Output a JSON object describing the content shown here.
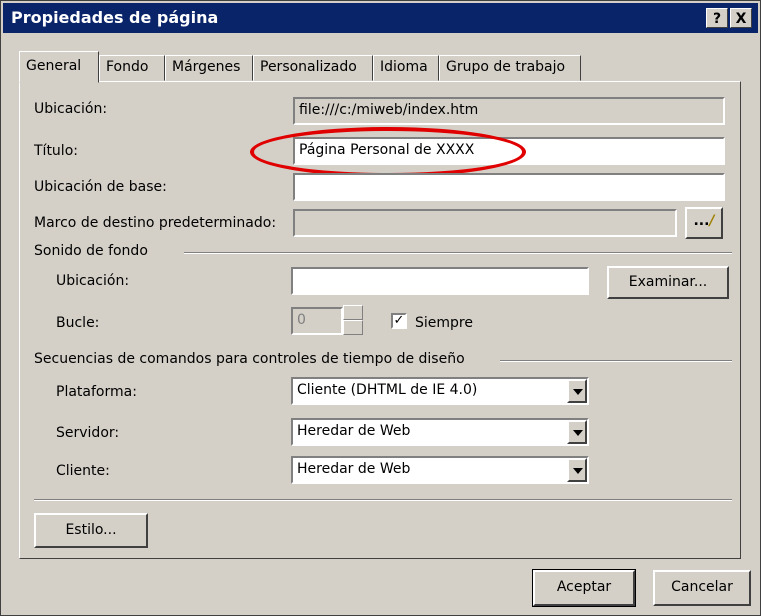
{
  "window": {
    "title": "Propiedades de página",
    "help_label": "?",
    "close_label": "X"
  },
  "tabs": [
    "General",
    "Fondo",
    "Márgenes",
    "Personalizado",
    "Idioma",
    "Grupo de trabajo"
  ],
  "general": {
    "location_label": "Ubicación:",
    "location_value": "file:///c:/miweb/index.htm",
    "title_label": "Título:",
    "title_value": "Página Personal de XXXX",
    "base_label": "Ubicación de base:",
    "base_value": "",
    "frame_label": "Marco de destino predeterminado:",
    "frame_value": "",
    "frame_button": "...",
    "sound_group": "Sonido de fondo",
    "sound_location_label": "Ubicación:",
    "sound_location_value": "",
    "browse_button": "Examinar...",
    "loop_label": "Bucle:",
    "loop_value": "0",
    "always_label": "Siempre",
    "always_checked": true,
    "scripts_group": "Secuencias de comandos para controles de tiempo de diseño",
    "platform_label": "Plataforma:",
    "platform_value": "Cliente (DHTML de IE 4.0)",
    "server_label": "Servidor:",
    "server_value": "Heredar de Web",
    "client_label": "Cliente:",
    "client_value": "Heredar de Web",
    "style_button": "Estilo..."
  },
  "footer": {
    "ok_button": "Aceptar",
    "cancel_button": "Cancelar"
  },
  "annotation": {
    "highlight_color": "#e00000"
  }
}
